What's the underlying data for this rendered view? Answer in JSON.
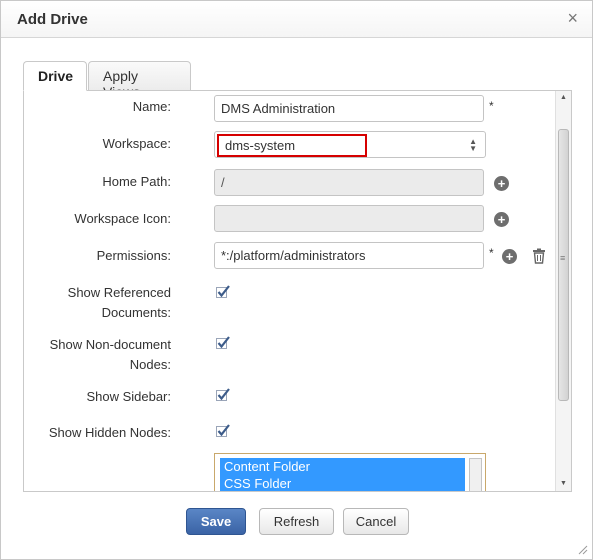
{
  "dialog": {
    "title": "Add Drive",
    "close_icon": "close-icon"
  },
  "tabs": [
    {
      "label": "Drive",
      "active": true
    },
    {
      "label": "Apply Views",
      "active": false
    }
  ],
  "form": {
    "name": {
      "label": "Name:",
      "value": "DMS Administration",
      "required": "*"
    },
    "workspace": {
      "label": "Workspace:",
      "value": "dms-system"
    },
    "home_path": {
      "label": "Home Path:",
      "value": "/"
    },
    "workspace_icon": {
      "label": "Workspace Icon:",
      "value": ""
    },
    "permissions": {
      "label": "Permissions:",
      "value": "*:/platform/administrators",
      "required": "*"
    },
    "show_referenced_documents": {
      "label_line1": "Show Referenced",
      "label_line2": "Documents:",
      "checked": true
    },
    "show_non_document_nodes": {
      "label_line1": "Show Non-document",
      "label_line2": "Nodes:",
      "checked": true
    },
    "show_sidebar": {
      "label": "Show Sidebar:",
      "checked": true
    },
    "show_hidden_nodes": {
      "label": "Show Hidden Nodes:",
      "checked": true
    },
    "folder_types": {
      "items": [
        "Content Folder",
        "CSS Folder"
      ]
    }
  },
  "buttons": {
    "save": "Save",
    "refresh": "Refresh",
    "cancel": "Cancel"
  },
  "colors": {
    "highlight_border": "#d60000",
    "primary_button": "#3a63a5",
    "selection": "#3399ff"
  }
}
